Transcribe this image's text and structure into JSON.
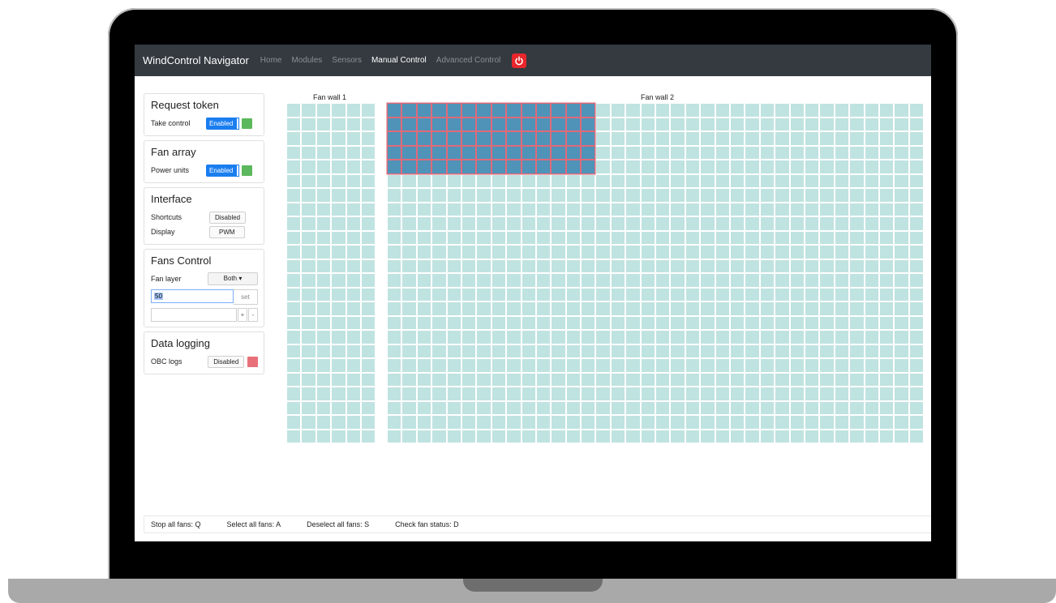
{
  "navbar": {
    "brand": "WindControl Navigator",
    "links": [
      "Home",
      "Modules",
      "Sensors",
      "Manual Control",
      "Advanced Control"
    ],
    "active_link": "Manual Control",
    "power_icon": "power-icon",
    "power_color": "#e8262b"
  },
  "sidebar": {
    "request_token": {
      "title": "Request token",
      "label": "Take control",
      "button": "Enabled",
      "status_color": "#5cb85c"
    },
    "fan_array": {
      "title": "Fan array",
      "label": "Power units",
      "button": "Enabled",
      "status_color": "#5cb85c"
    },
    "interface": {
      "title": "Interface",
      "shortcuts_label": "Shortcuts",
      "shortcuts_value": "Disabled",
      "display_label": "Display",
      "display_value": "PWM"
    },
    "fans_control": {
      "title": "Fans Control",
      "layer_label": "Fan layer",
      "layer_value": "Both",
      "pwm_value": "50",
      "set_label": "set",
      "plus_label": "+",
      "minus_label": "-"
    },
    "data_logging": {
      "title": "Data logging",
      "label": "OBC logs",
      "button": "Disabled",
      "status_color": "#e8707a"
    }
  },
  "fan_walls": [
    {
      "label": "Fan wall 1",
      "columns": 6,
      "rows": 24,
      "selected": []
    },
    {
      "label": "Fan wall 2",
      "columns": 36,
      "rows": 24,
      "selected_rows": [
        0,
        1,
        2,
        3,
        4
      ],
      "selected_columns": [
        0,
        1,
        2,
        3,
        4,
        5,
        6,
        7,
        8,
        9,
        10,
        11,
        12,
        13
      ]
    }
  ],
  "colors": {
    "fan_idle": "#bfe3e1",
    "fan_selected": "#4f93b8",
    "fan_selected_border": "#e06a7a"
  },
  "shortcuts": [
    "Stop all fans: Q",
    "Select all fans: A",
    "Deselect all fans: S",
    "Check fan status: D"
  ]
}
